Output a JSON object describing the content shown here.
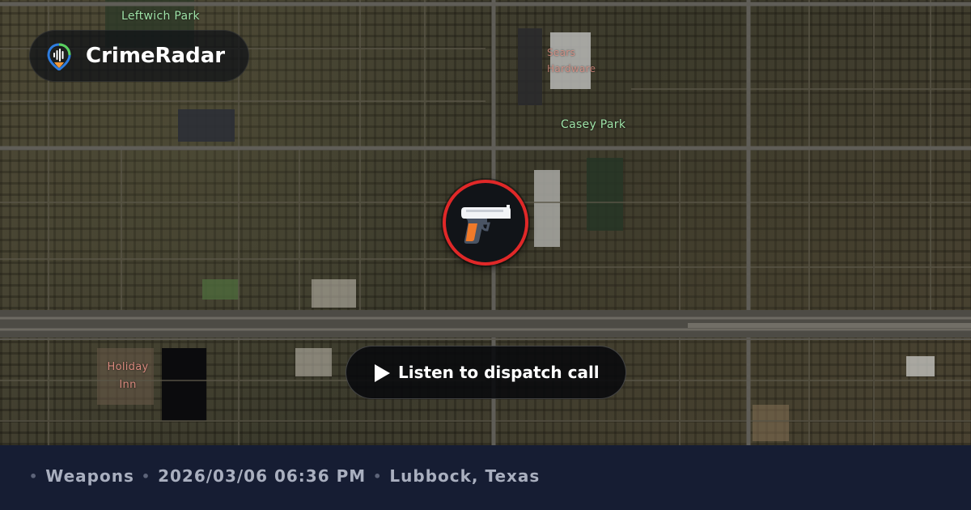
{
  "brand": {
    "name": "CrimeRadar",
    "icon": "crimeradar-pin-icon"
  },
  "map": {
    "labels": {
      "leftwich_park": "Leftwich Park",
      "casey_park": "Casey Park",
      "holiday_inn": "Holiday Inn",
      "store": "Sears Hardware"
    }
  },
  "incident": {
    "type": "Weapons",
    "icon": "handgun-icon",
    "marker_color": "#e02828"
  },
  "action": {
    "listen_label": "Listen to dispatch call",
    "icon": "play-icon"
  },
  "footer": {
    "category": "Weapons",
    "datetime": "2026/03/06 06:36 PM",
    "location": "Lubbock, Texas"
  }
}
